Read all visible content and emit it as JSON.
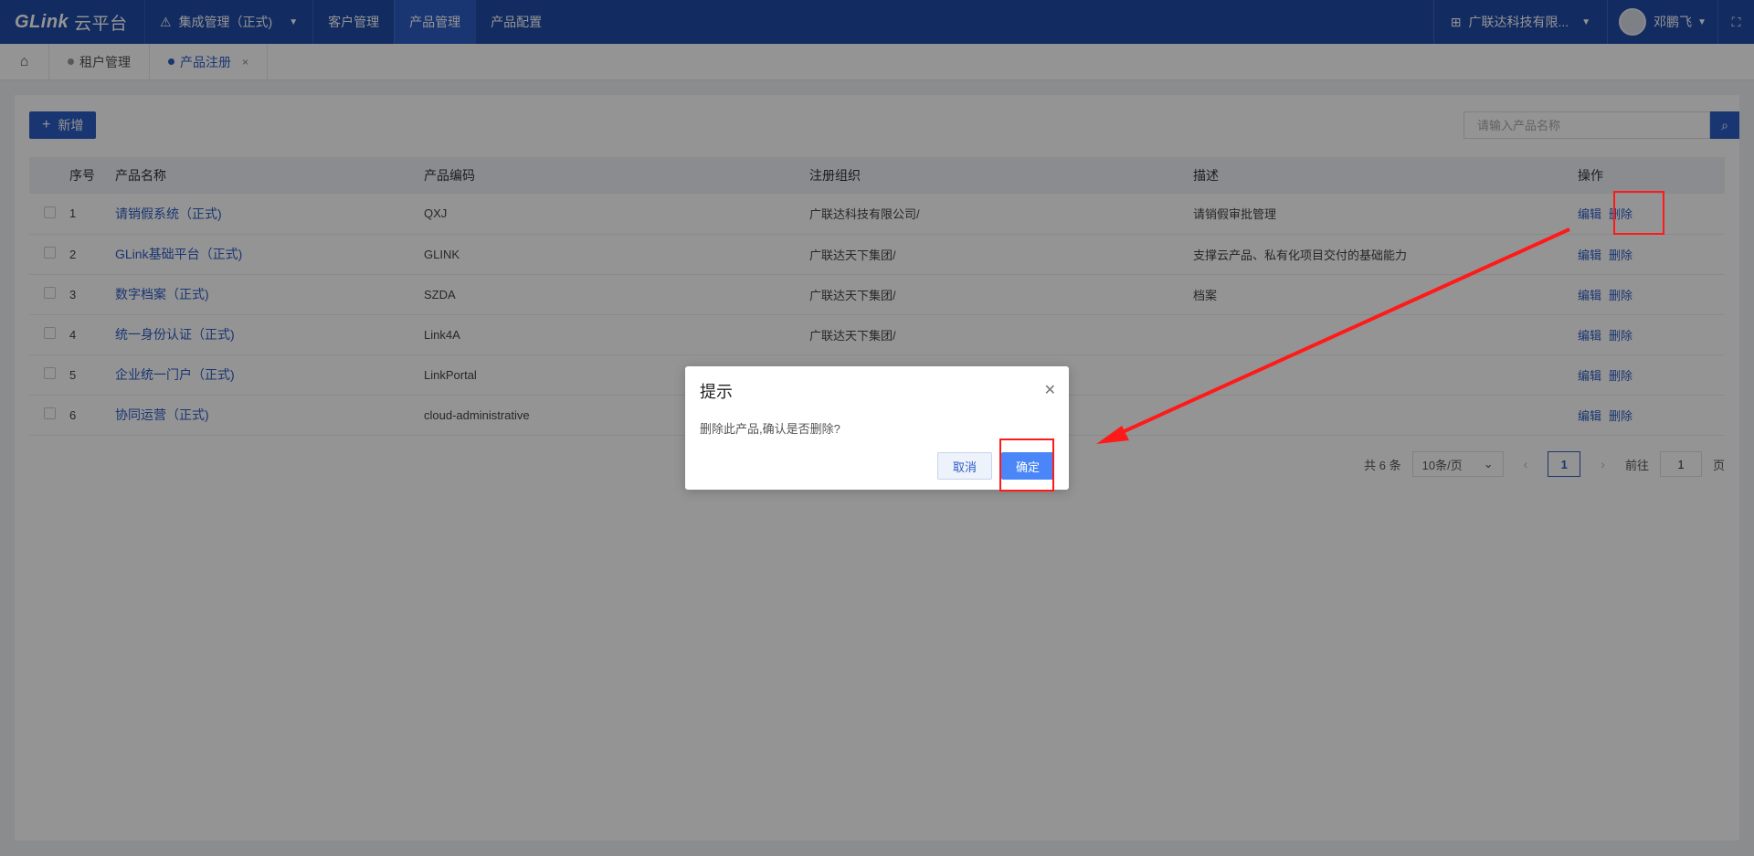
{
  "topnav": {
    "logo": "GLink",
    "logo_sub": "云平台",
    "items": [
      {
        "label": "集成管理（正式)"
      },
      {
        "label": "客户管理"
      },
      {
        "label": "产品管理"
      },
      {
        "label": "产品配置"
      }
    ],
    "org": "广联达科技有限...",
    "user": "邓鹏飞"
  },
  "tabs": [
    {
      "label": "租户管理"
    },
    {
      "label": "产品注册",
      "close": "×"
    }
  ],
  "toolbar": {
    "add_label": "新增",
    "search_placeholder": "请输入产品名称"
  },
  "table": {
    "headers": [
      "序号",
      "产品名称",
      "产品编码",
      "注册组织",
      "描述",
      "操作"
    ],
    "rows": [
      {
        "no": "1",
        "name": "请销假系统（正式)",
        "code": "QXJ",
        "org": "广联达科技有限公司/",
        "desc": "请销假审批管理",
        "edit": "编辑",
        "del": "删除"
      },
      {
        "no": "2",
        "name": "GLink基础平台（正式)",
        "code": "GLINK",
        "org": "广联达天下集团/",
        "desc": "支撑云产品、私有化项目交付的基础能力",
        "edit": "编辑",
        "del": "删除"
      },
      {
        "no": "3",
        "name": "数字档案（正式)",
        "code": "SZDA",
        "org": "广联达天下集团/",
        "desc": "档案",
        "edit": "编辑",
        "del": "删除"
      },
      {
        "no": "4",
        "name": "统一身份认证（正式)",
        "code": "Link4A",
        "org": "广联达天下集团/",
        "desc": "",
        "edit": "编辑",
        "del": "删除"
      },
      {
        "no": "5",
        "name": "企业统一门户（正式)",
        "code": "LinkPortal",
        "org": "",
        "desc": "",
        "edit": "编辑",
        "del": "删除"
      },
      {
        "no": "6",
        "name": "协同运营（正式)",
        "code": "cloud-administrative",
        "org": "",
        "desc": "",
        "edit": "编辑",
        "del": "删除"
      }
    ]
  },
  "pagination": {
    "total": "共 6 条",
    "page_size": "10条/页",
    "current": "1",
    "goto_label": "前往",
    "goto_value": "1",
    "page_suffix": "页"
  },
  "dialog": {
    "title": "提示",
    "message": "删除此产品,确认是否删除?",
    "cancel": "取消",
    "confirm": "确定"
  },
  "colors": {
    "nav_bg": "#1f4aa8",
    "primary": "#2d5dc4",
    "annotation": "#ff1a1a"
  }
}
